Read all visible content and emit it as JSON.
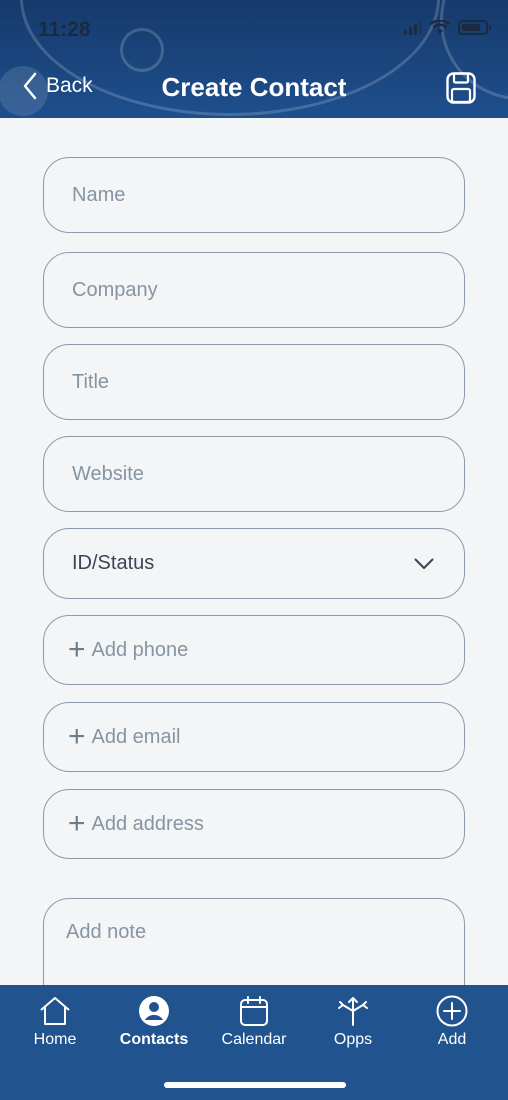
{
  "status_bar": {
    "time": "11:28"
  },
  "header": {
    "back_label": "Back",
    "title": "Create Contact"
  },
  "form": {
    "name_placeholder": "Name",
    "company_placeholder": "Company",
    "title_placeholder": "Title",
    "website_placeholder": "Website",
    "status_select": "ID/Status",
    "add_phone": "Add phone",
    "add_email": "Add email",
    "add_address": "Add address",
    "add_note": "Add note"
  },
  "tabbar": {
    "items": [
      {
        "label": "Home",
        "icon": "home-icon"
      },
      {
        "label": "Contacts",
        "icon": "person-icon",
        "active": true
      },
      {
        "label": "Calendar",
        "icon": "calendar-icon"
      },
      {
        "label": "Opps",
        "icon": "split-arrows-icon"
      },
      {
        "label": "Add",
        "icon": "plus-circle-icon"
      }
    ]
  },
  "colors": {
    "header": "#1e4f8d",
    "tabbar": "#21538f",
    "field_border": "#8e9aa9",
    "background": "#f4f5f7"
  }
}
